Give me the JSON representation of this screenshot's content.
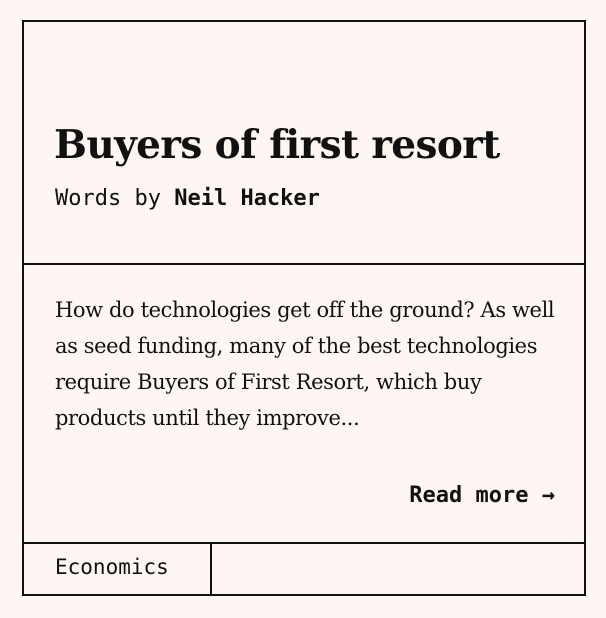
{
  "article": {
    "title": "Buyers of first resort",
    "byline_prefix": "Words by",
    "author": "Neil Hacker",
    "excerpt": "How do technologies get off the ground? As well as seed funding, many of the best technologies require Buyers of First Resort, which buy products until they improve...",
    "read_more_label": "Read more",
    "read_more_arrow": "→",
    "tags": [
      "Economics"
    ]
  },
  "colors": {
    "background": "#fdf6f2",
    "ink": "#111111"
  }
}
